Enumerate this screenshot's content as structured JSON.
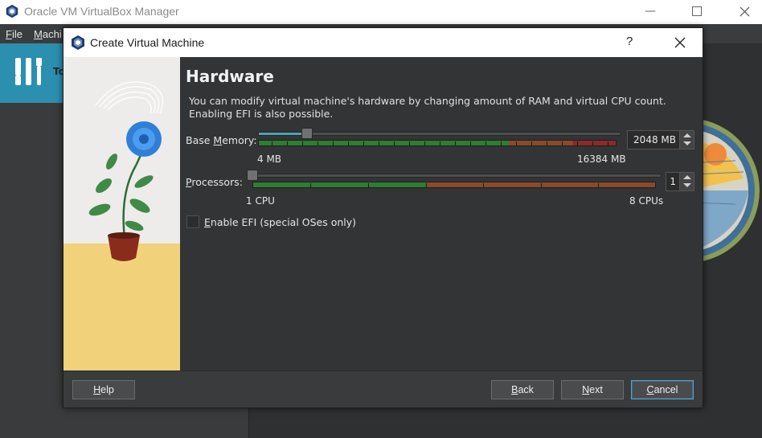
{
  "main_window": {
    "title": "Oracle VM VirtualBox Manager",
    "menu": [
      {
        "label": "File",
        "mnemonic": "F",
        "rest": "ile"
      },
      {
        "label": "Machi",
        "mnemonic": "M",
        "rest": "achi"
      }
    ],
    "tools_label": "To"
  },
  "dialog": {
    "title": "Create Virtual Machine",
    "help_glyph": "?",
    "page_title": "Hardware",
    "description_line1": "You can modify virtual machine's hardware by changing amount of RAM and virtual CPU count.",
    "description_line2": "Enabling EFI is also possible.",
    "memory": {
      "label_pre": "Base ",
      "label_mnemonic": "M",
      "label_post": "emory:",
      "min_label": "4 MB",
      "max_label": "16384 MB",
      "value": "2048 MB",
      "value_fraction": 0.125
    },
    "processors": {
      "label_mnemonic": "P",
      "label_post": "rocessors:",
      "min_label": "1 CPU",
      "max_label": "8 CPUs",
      "value": "1",
      "value_fraction": 0
    },
    "efi": {
      "label_mnemonic": "E",
      "label_post": "nable EFI (special OSes only)",
      "checked": false
    },
    "buttons": {
      "help": {
        "mnemonic": "H",
        "rest": "elp"
      },
      "back": {
        "mnemonic": "B",
        "rest": "ack"
      },
      "next": {
        "mnemonic": "N",
        "rest": "ext"
      },
      "cancel": {
        "mnemonic": "C",
        "rest": "ancel"
      }
    }
  },
  "colors": {
    "accent": "#4aa3b8",
    "scale_green": "#2e7d32",
    "scale_orange": "#8a4a2a",
    "scale_red": "#8a2a2a",
    "tools_blue": "#2b8fb0",
    "art_yellow": "#f2d67a"
  },
  "icons": [
    "virtualbox-logo-icon",
    "minimize-icon",
    "maximize-icon",
    "close-icon",
    "tools-icon",
    "help-icon"
  ]
}
